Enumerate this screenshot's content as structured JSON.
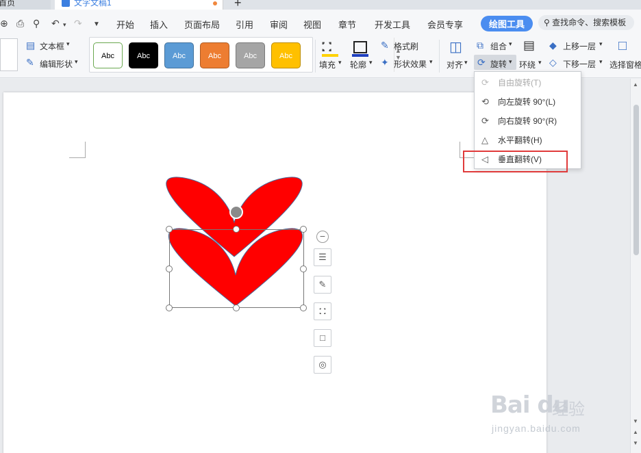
{
  "tabs": {
    "home_label": "首页",
    "doc_title": "文字文稿1",
    "add": "+"
  },
  "menu": {
    "items": [
      "开始",
      "插入",
      "页面布局",
      "引用",
      "审阅",
      "视图",
      "章节",
      "开发工具",
      "会员专享"
    ],
    "active_tab": "绘图工具",
    "search_placeholder": "查找命令、搜索模板"
  },
  "ribbon": {
    "text_box": "文本框",
    "edit_shape": "编辑形状",
    "style_swatches": [
      {
        "label": "Abc",
        "bg": "#ffffff",
        "fg": "#000000",
        "border": "#6aa84f"
      },
      {
        "label": "Abc",
        "bg": "#000000",
        "fg": "#ffffff",
        "border": "#000000"
      },
      {
        "label": "Abc",
        "bg": "#5b9bd5",
        "fg": "#ffffff",
        "border": "#41719c"
      },
      {
        "label": "Abc",
        "bg": "#ed7d31",
        "fg": "#ffffff",
        "border": "#ae5a21"
      },
      {
        "label": "Abc",
        "bg": "#a5a5a5",
        "fg": "#ffffff",
        "border": "#787878"
      },
      {
        "label": "Abc",
        "bg": "#ffc000",
        "fg": "#ffffff",
        "border": "#bc8c00"
      }
    ],
    "fill": "填充",
    "outline": "轮廓",
    "format_painter": "格式刷",
    "shape_effects": "形状效果",
    "align": "对齐",
    "group": "组合",
    "rotate": "旋转",
    "wrap": "环绕",
    "bring_forward": "上移一层",
    "send_backward": "下移一层",
    "selection_pane": "选择窗格"
  },
  "rotate_menu": {
    "items": [
      {
        "label": "自由旋转(T)",
        "disabled": true
      },
      {
        "label": "向左旋转 90°(L)",
        "disabled": false
      },
      {
        "label": "向右旋转 90°(R)",
        "disabled": false
      },
      {
        "label": "水平翻转(H)",
        "disabled": false
      },
      {
        "label": "垂直翻转(V)",
        "disabled": false
      }
    ],
    "highlighted": "垂直翻转(V)"
  },
  "shapes": {
    "fill_color": "#ff0000",
    "outline_color": "#4a6a9a"
  },
  "colors": {
    "accent": "#4b8df0",
    "highlight": "#e03a3a"
  },
  "watermark": {
    "brand": "Bai du",
    "sub": "经验",
    "url": "jingyan.baidu.com"
  }
}
